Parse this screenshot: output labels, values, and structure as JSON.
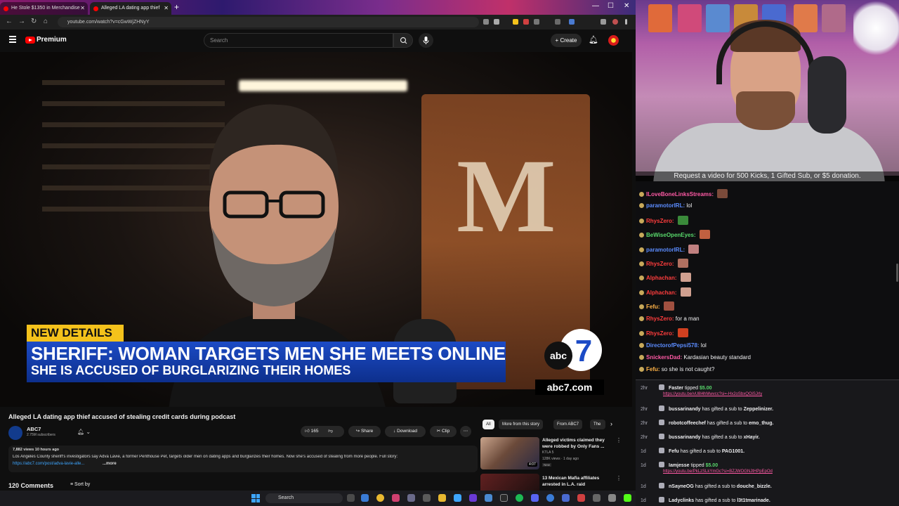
{
  "browser": {
    "tabs": [
      {
        "title": "He Stole $1350 in Merchandise"
      },
      {
        "title": "Alleged LA dating app thief"
      }
    ],
    "url": "youtube.com/watch?v=cGwWjZHNyY"
  },
  "youtube": {
    "brand": "Premium",
    "search_placeholder": "Search",
    "create_label": "Create"
  },
  "video": {
    "banner_tag": "NEW DETAILS",
    "headline": "SHERIFF: WOMAN TARGETS MEN SHE MEETS ONLINE",
    "subheadline": "SHE IS ACCUSED OF BURGLARIZING THEIR HOMES",
    "logo_text": "abc",
    "logo_number": "7",
    "site": "abc7.com",
    "title": "Alleged LA dating app thief accused of stealing credit cards during podcast",
    "channel": "ABC7",
    "subscribers": "2.75M subscribers",
    "likes": "165",
    "share_label": "Share",
    "download_label": "Download",
    "clip_label": "Clip",
    "views_meta": "7,882 views  10 hours ago",
    "description": "Los Angeles County sheriff's investigators say Adva Lavie, a former Penthouse Pet, targets older men on dating apps and burglarizes their homes. Now she's accused of stealing from more people. Full story:",
    "description_link": "https://abc7.com/post/adva-lavie-alle...",
    "more_label": "...more",
    "comments": "120 Comments",
    "sort_label": "Sort by"
  },
  "related": {
    "chips": [
      "All",
      "More from this story",
      "From ABC7",
      "The"
    ],
    "items": [
      {
        "title": "Alleged victims claimed they were robbed by Only Fans ...",
        "channel": "KTLA 5",
        "meta": "128K views · 1 day ago",
        "badge": "New",
        "duration": "4:07"
      },
      {
        "title": "13 Mexican Mafia affiliates arrested in L.A. raid"
      }
    ]
  },
  "taskbar": {
    "search_label": "Search"
  },
  "stream": {
    "request_banner": "Request a video for 500 Kicks, 1 Gifted Sub, or $5 donation.",
    "chat": [
      {
        "user": "ILoveBoneLinksStreams:",
        "text": "",
        "color": "u-pink",
        "emote": "#7a4a3a"
      },
      {
        "user": "paramotorIRL:",
        "text": "lol",
        "color": "u-blue",
        "emote": ""
      },
      {
        "user": "RhysZero:",
        "text": "",
        "color": "u-red",
        "emote": "#3a8a3a"
      },
      {
        "user": "BeWiseOpenEyes:",
        "text": "",
        "color": "u-green",
        "emote": "#c06040"
      },
      {
        "user": "paramotorIRL:",
        "text": "",
        "color": "u-blue",
        "emote": "#c08080"
      },
      {
        "user": "RhysZero:",
        "text": "",
        "color": "u-red",
        "emote": "#b07060"
      },
      {
        "user": "Alphachan:",
        "text": "",
        "color": "u-red",
        "emote": "#d0a090"
      },
      {
        "user": "Alphachan:",
        "text": "",
        "color": "u-red",
        "emote": "#d0a090"
      },
      {
        "user": "Fefu:",
        "text": "",
        "color": "u-orange",
        "emote": "#a05040"
      },
      {
        "user": "RhysZero:",
        "text": "for a man",
        "color": "u-red",
        "emote": ""
      },
      {
        "user": "RhysZero:",
        "text": "",
        "color": "u-red",
        "emote": "#d04020"
      },
      {
        "user": "DirectorofPepsi578:",
        "text": "lol",
        "color": "u-blue",
        "emote": ""
      },
      {
        "user": "SnickersDad:",
        "text": "Kardasian beauty standard",
        "color": "u-pink",
        "emote": ""
      },
      {
        "user": "Fefu:",
        "text": "so she is not caught?",
        "color": "u-orange",
        "emote": ""
      }
    ],
    "events": [
      {
        "time": "2hr",
        "user": "Faster",
        "mid": "tipped",
        "target": "$5.00",
        "link": "https://youtu.be/vU8l4hMwvcc?si=-Hx2oSbxQOiSJrly"
      },
      {
        "time": "2hr",
        "user": "bussarinandy",
        "mid": "has gifted a sub to",
        "target": "Zeppelinizer.",
        "link": ""
      },
      {
        "time": "2hr",
        "user": "robotcoffeechef",
        "mid": "has gifted a sub to",
        "target": "emo_thug.",
        "link": ""
      },
      {
        "time": "2hr",
        "user": "bussarinandy",
        "mid": "has gifted a sub to",
        "target": "xHayir.",
        "link": ""
      },
      {
        "time": "1d",
        "user": "Fefu",
        "mid": "has gifted a sub to",
        "target": "PAG1001.",
        "link": ""
      },
      {
        "time": "1d",
        "user": "Iamjesse",
        "mid": "tipped",
        "target": "$5.00",
        "link": "https://youtu.be/PkLzSLkYmGc?si=BZJWOGNJtHPpEpOd"
      },
      {
        "time": "1d",
        "user": "nSayneOG",
        "mid": "has gifted a sub to",
        "target": "douche_bizzle.",
        "link": ""
      },
      {
        "time": "1d",
        "user": "Ladyclinks",
        "mid": "has gifted a sub to",
        "target": "l3t1tmarinade.",
        "link": ""
      }
    ]
  }
}
